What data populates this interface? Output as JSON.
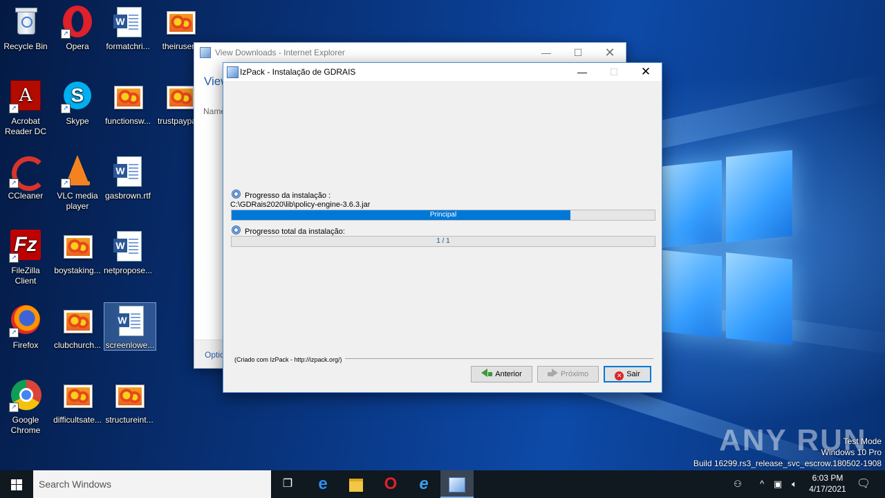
{
  "desktop": {
    "icons": [
      {
        "label": "Recycle Bin",
        "icon": "recycle-bin-icon"
      },
      {
        "label": "Opera",
        "icon": "opera-icon"
      },
      {
        "label": "formatchri...",
        "icon": "word-document-icon"
      },
      {
        "label": "theirusers",
        "icon": "image-file-icon"
      },
      {
        "label": "Acrobat Reader DC",
        "icon": "acrobat-icon"
      },
      {
        "label": "Skype",
        "icon": "skype-icon"
      },
      {
        "label": "functionsw...",
        "icon": "image-file-icon"
      },
      {
        "label": "trustpaypa...",
        "icon": "image-file-icon"
      },
      {
        "label": "CCleaner",
        "icon": "ccleaner-icon"
      },
      {
        "label": "VLC media player",
        "icon": "vlc-icon"
      },
      {
        "label": "gasbrown.rtf",
        "icon": "word-document-icon"
      },
      {
        "label": "FileZilla Client",
        "icon": "filezilla-icon"
      },
      {
        "label": "boystaking...",
        "icon": "image-file-icon"
      },
      {
        "label": "netpropose...",
        "icon": "word-document-icon"
      },
      {
        "label": "Firefox",
        "icon": "firefox-icon"
      },
      {
        "label": "clubchurch...",
        "icon": "image-file-icon"
      },
      {
        "label": "screenlowe...",
        "icon": "word-document-icon"
      },
      {
        "label": "Google Chrome",
        "icon": "chrome-icon"
      },
      {
        "label": "difficultsate...",
        "icon": "image-file-icon"
      },
      {
        "label": "structureint...",
        "icon": "image-file-icon"
      }
    ]
  },
  "ie_window": {
    "title": "View Downloads - Internet Explorer",
    "heading": "View",
    "column_name": "Name",
    "options_link": "Optio"
  },
  "izpack": {
    "title": "IzPack - Instalação de GDRAIS",
    "progress_label": "Progresso da instalação :",
    "current_file": "C:\\GDRais2020\\lib\\policy-engine-3.6.3.jar",
    "pack_progress_text": "Principal",
    "pack_progress_fraction": 0.8,
    "total_label": "Progresso total da instalação:",
    "total_progress_text": "1 / 1",
    "total_progress_fraction": 0.0,
    "credit": "(Criado com IzPack - http://izpack.org/)",
    "buttons": {
      "back": "Anterior",
      "next": "Próximo",
      "quit": "Sair"
    }
  },
  "watermark": {
    "brand": "ANY RUN",
    "mode": "Test Mode",
    "os": "Windows 10 Pro",
    "build": "Build 16299.rs3_release_svc_escrow.180502-1908"
  },
  "taskbar": {
    "search_placeholder": "Search Windows",
    "time": "6:03 PM",
    "date": "4/17/2021"
  },
  "colors": {
    "accent": "#0078d7",
    "taskbar": "#101820"
  }
}
